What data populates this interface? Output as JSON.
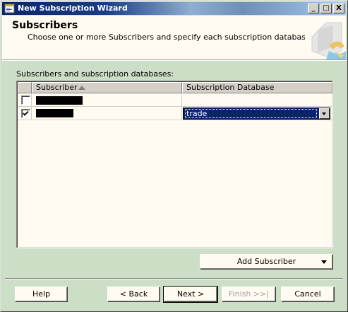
{
  "window": {
    "title": "New Subscription Wizard",
    "controls": {
      "minimize": "_",
      "maximize": "□",
      "close": "X"
    }
  },
  "header": {
    "title": "Subscribers",
    "subtitle": "Choose one or more Subscribers and specify each subscription database."
  },
  "grid": {
    "label": "Subscribers and subscription databases:",
    "columns": [
      "Subscriber",
      "Subscription Database"
    ],
    "sort": "ascending",
    "rows": [
      {
        "checked": false,
        "subscriber": "",
        "database": ""
      },
      {
        "checked": true,
        "subscriber": "",
        "database": "trade"
      }
    ]
  },
  "add_subscriber": {
    "label": "Add Subscriber"
  },
  "footer": {
    "help": "Help",
    "back": "< Back",
    "next": "Next >",
    "finish": "Finish >>|",
    "cancel": "Cancel"
  },
  "colors": {
    "title_bar": "#0a246a",
    "dialog_bg": "#ccdfc6",
    "panel_bg": "#fffbf0",
    "selection": "#0a246a"
  }
}
